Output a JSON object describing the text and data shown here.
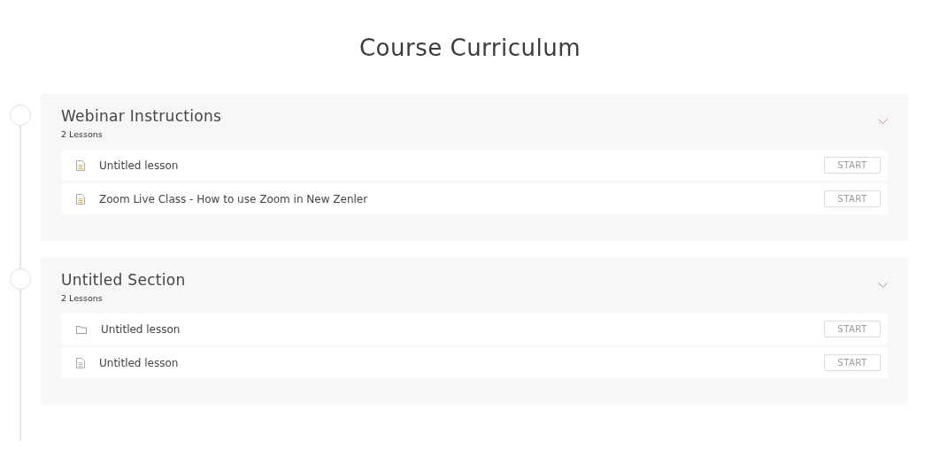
{
  "title": "Course Curriculum",
  "sections": [
    {
      "title": "Webinar Instructions",
      "count": "2 Lessons",
      "lessons": [
        {
          "kind": "text",
          "title": "Untitled lesson",
          "action": "START"
        },
        {
          "kind": "text",
          "title": "Zoom Live Class - How to use Zoom in New Zenler",
          "action": "START"
        }
      ]
    },
    {
      "title": "Untitled Section",
      "count": "2 Lessons",
      "lessons": [
        {
          "kind": "video",
          "title": "Untitled lesson",
          "action": "START"
        },
        {
          "kind": "text",
          "title": "Untitled lesson",
          "action": "START"
        }
      ]
    }
  ]
}
